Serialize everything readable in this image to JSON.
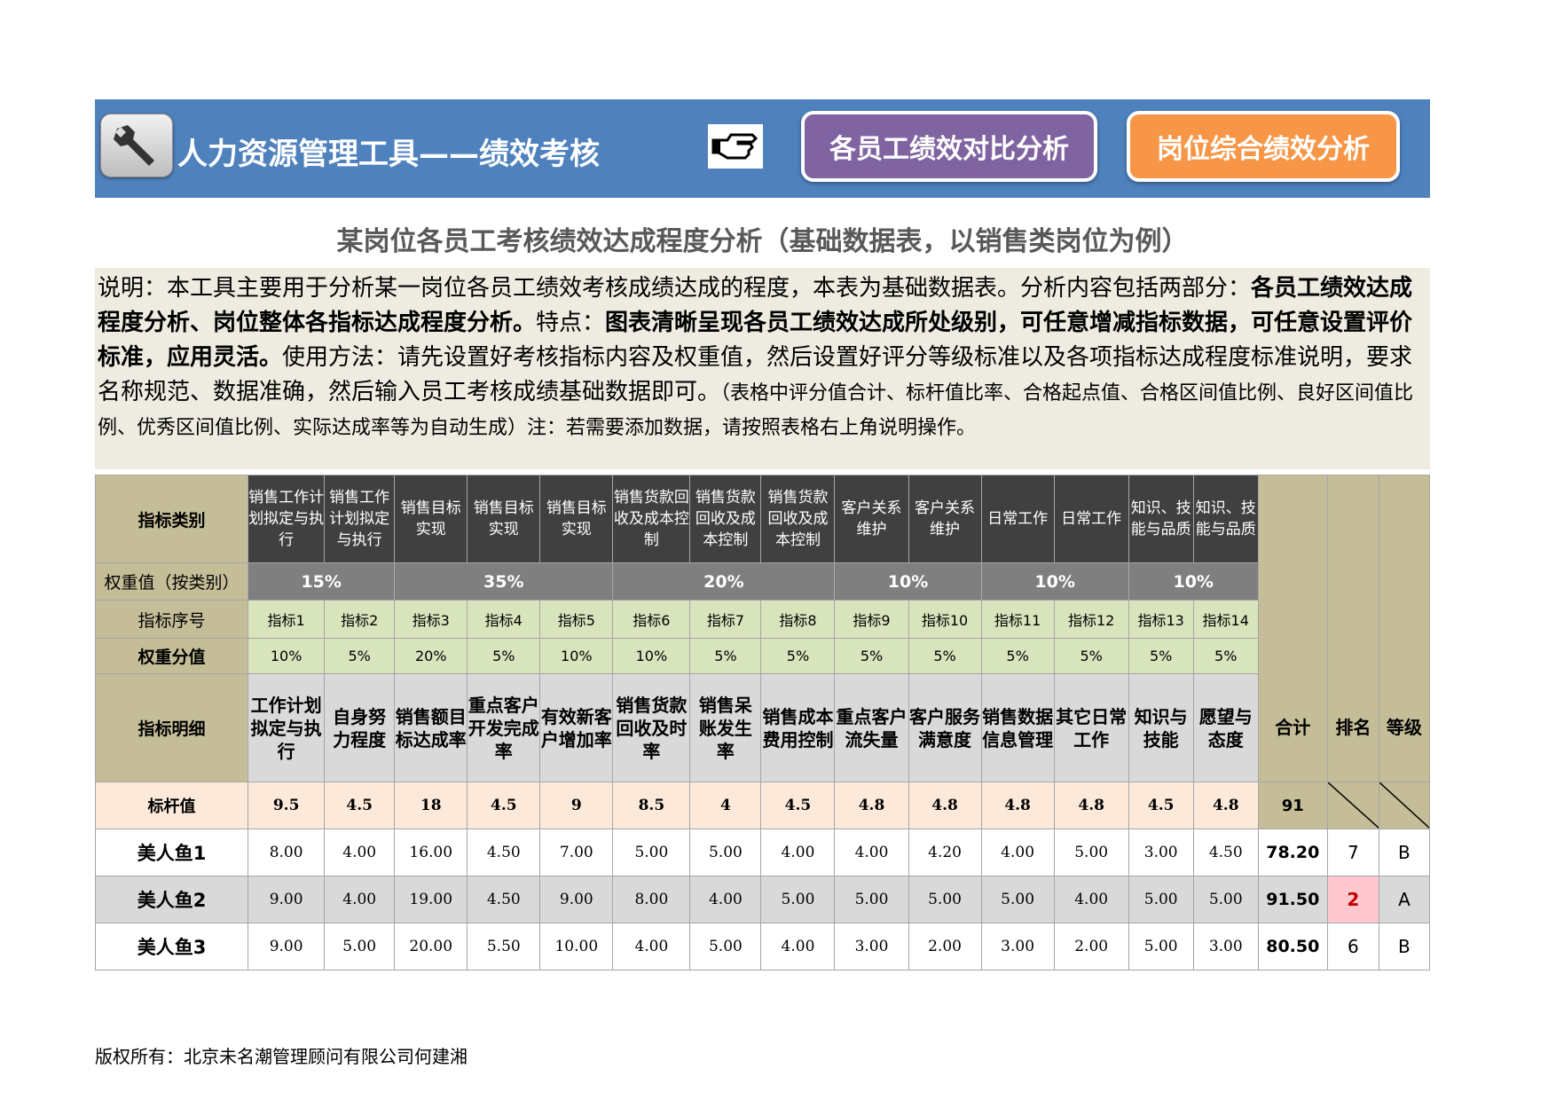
{
  "header": {
    "app_title": "人力资源管理工具——绩效考核",
    "btn_compare": "各员工绩效对比分析",
    "btn_position": "岗位综合绩效分析",
    "logo_icon": "wrench-icon",
    "pointer_icon": "pointing-hand-icon",
    "colors": {
      "banner": "#4f81bd",
      "btn_compare": "#8064a2",
      "btn_position": "#f79646"
    }
  },
  "page_title": "某岗位各员工考核绩效达成程度分析（基础数据表，以销售类岗位为例）",
  "description": {
    "p1": "说明：本工具主要用于分析某一岗位各员工绩效考核成绩达成的程度，本表为基础数据表。分析内容包括两部分：",
    "b1": "各员工绩效达成程度分析、岗位整体各指标达成程度分析。",
    "p2": "特点：",
    "b2": "图表清晰呈现各员工绩效达成所处级别，可任意增减指标数据，可任意设置评价标准，应用灵活。",
    "p3": "使用方法：请先设置好考核指标内容及权重值，然后设置好评分等级标准以及各项指标达成程度标准说明，要求名称规范、数据准确，然后输入员工考核成绩基础数据即可。",
    "small": "（表格中评分值合计、标杆值比率、合格起点值、合格区间值比例、良好区间值比例、优秀区间值比例、实际达成率等为自动生成）注：若需要添加数据，请按照表格右上角说明操作。"
  },
  "table": {
    "labels": {
      "category": "指标类别",
      "weight_by_category": "权重值（按类别）",
      "index_no": "指标序号",
      "weight_score": "权重分值",
      "detail": "指标明细",
      "benchmark": "标杆值",
      "total": "合计",
      "rank": "排名",
      "grade": "等级"
    },
    "categories": [
      "销售工作计划拟定与执行",
      "销售工作计划拟定与执行",
      "销售目标实现",
      "销售目标实现",
      "销售目标实现",
      "销售货款回收及成本控制",
      "销售货款回收及成本控制",
      "销售货款回收及成本控制",
      "客户关系维护",
      "客户关系维护",
      "日常工作",
      "日常工作",
      "知识、技能与品质",
      "知识、技能与品质"
    ],
    "category_weights": [
      "15%",
      "35%",
      "20%",
      "10%",
      "10%",
      "10%"
    ],
    "indices": [
      "指标1",
      "指标2",
      "指标3",
      "指标4",
      "指标5",
      "指标6",
      "指标7",
      "指标8",
      "指标9",
      "指标10",
      "指标11",
      "指标12",
      "指标13",
      "指标14"
    ],
    "weights": [
      "10%",
      "5%",
      "20%",
      "5%",
      "10%",
      "10%",
      "5%",
      "5%",
      "5%",
      "5%",
      "5%",
      "5%",
      "5%",
      "5%"
    ],
    "details": [
      "工作计划拟定与执行",
      "自身努力程度",
      "销售额目标达成率",
      "重点客户开发完成率",
      "有效新客户增加率",
      "销售货款回收及时率",
      "销售呆账发生率",
      "销售成本费用控制",
      "重点客户流失量",
      "客户服务满意度",
      "销售数据信息管理",
      "其它日常工作",
      "知识与技能",
      "愿望与态度"
    ],
    "benchmarks": [
      "9.5",
      "4.5",
      "18",
      "4.5",
      "9",
      "8.5",
      "4",
      "4.5",
      "4.8",
      "4.8",
      "4.8",
      "4.8",
      "4.5",
      "4.8"
    ],
    "benchmark_total": "91",
    "employees": [
      {
        "name": "美人鱼1",
        "scores": [
          "8.00",
          "4.00",
          "16.00",
          "4.50",
          "7.00",
          "5.00",
          "5.00",
          "4.00",
          "4.00",
          "4.20",
          "4.00",
          "5.00",
          "3.00",
          "4.50"
        ],
        "total": "78.20",
        "rank": "7",
        "grade": "B"
      },
      {
        "name": "美人鱼2",
        "scores": [
          "9.00",
          "4.00",
          "19.00",
          "4.50",
          "9.00",
          "8.00",
          "4.00",
          "5.00",
          "5.00",
          "5.00",
          "5.00",
          "4.00",
          "5.00",
          "5.00"
        ],
        "total": "91.50",
        "rank": "2",
        "grade": "A"
      },
      {
        "name": "美人鱼3",
        "scores": [
          "9.00",
          "5.00",
          "20.00",
          "5.50",
          "10.00",
          "4.00",
          "5.00",
          "4.00",
          "3.00",
          "2.00",
          "3.00",
          "2.00",
          "5.00",
          "3.00"
        ],
        "total": "80.50",
        "rank": "6",
        "grade": "B"
      }
    ]
  },
  "copyright": "版权所有：北京未名潮管理顾问有限公司何建湘"
}
